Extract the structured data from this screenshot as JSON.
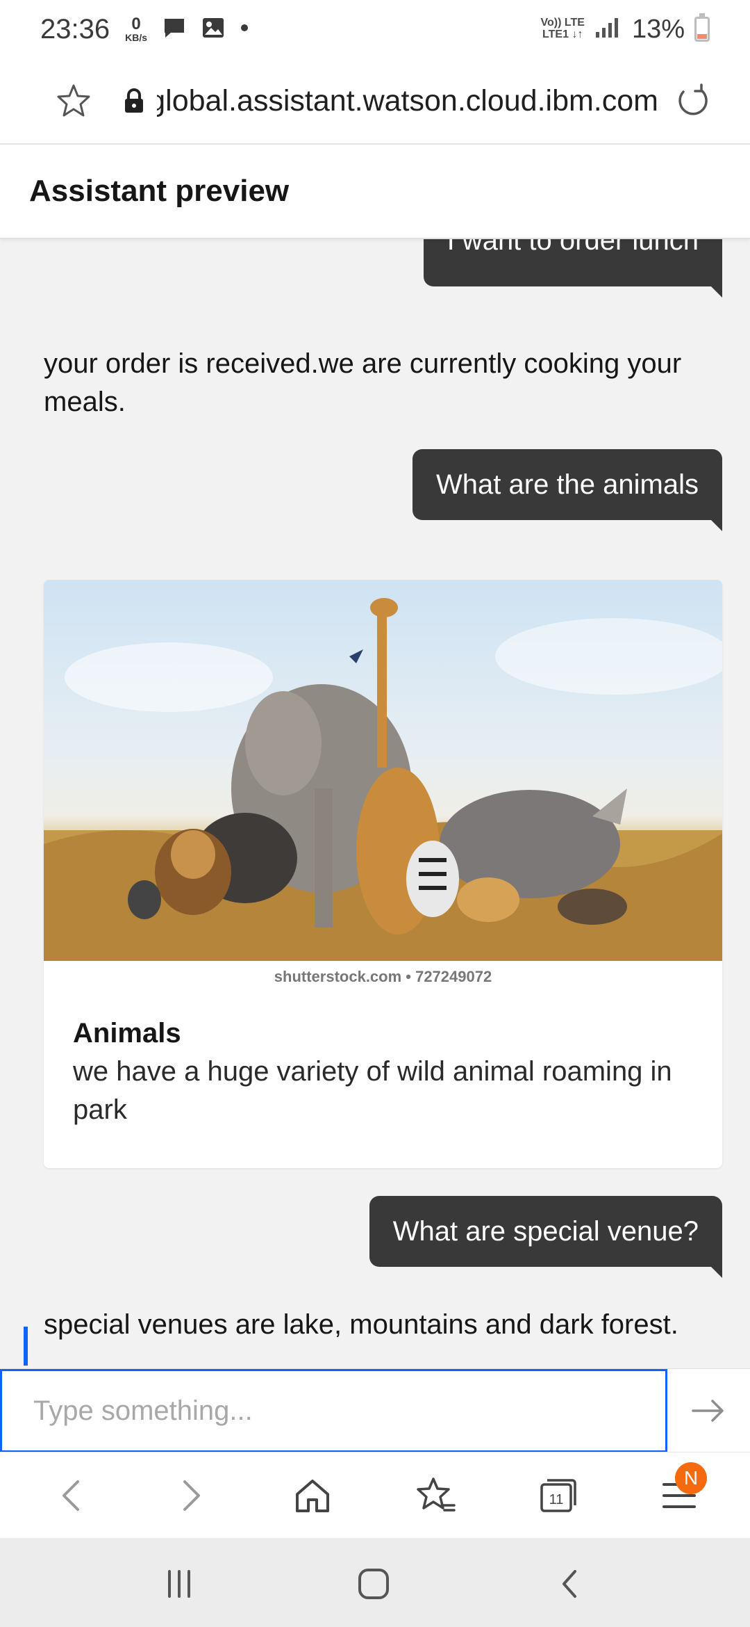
{
  "status_bar": {
    "time": "23:36",
    "data_rate_value": "0",
    "data_rate_unit": "KB/s",
    "network_label_top": "Vo)) LTE",
    "network_label_bottom": "LTE1 ↓↑",
    "battery_percent": "13%"
  },
  "browser": {
    "url": "global.assistant.watson.cloud.ibm.com",
    "tab_count": "11",
    "menu_badge": "N"
  },
  "header": {
    "title": "Assistant preview"
  },
  "chat": {
    "messages": [
      {
        "from": "user",
        "text": "I want to order lunch"
      },
      {
        "from": "bot",
        "text": "your order is received.we are currently cooking your meals."
      },
      {
        "from": "user",
        "text": "What are the animals"
      },
      {
        "from": "user",
        "text": "What are special venue?"
      },
      {
        "from": "bot",
        "text": "special venues are lake, mountains and dark forest."
      }
    ],
    "card": {
      "image_caption": "shutterstock.com • 727249072",
      "title": "Animals",
      "description": "we have a huge variety of wild animal roaming in park"
    }
  },
  "input": {
    "placeholder": "Type something..."
  },
  "icons": {
    "status": [
      "message-icon",
      "gallery-icon",
      "signal-icon",
      "battery-icon"
    ],
    "url_bar": [
      "star-icon",
      "lock-icon",
      "refresh-icon"
    ],
    "toolbar": [
      "back-arrow-icon",
      "forward-arrow-icon",
      "home-icon",
      "bookmarks-icon",
      "tabs-icon",
      "menu-icon"
    ],
    "system": [
      "recents-icon",
      "home-circle-icon",
      "system-back-icon"
    ]
  },
  "colors": {
    "user_bubble": "#393939",
    "focus_blue": "#0f62fe",
    "badge_orange": "#f5690f"
  }
}
